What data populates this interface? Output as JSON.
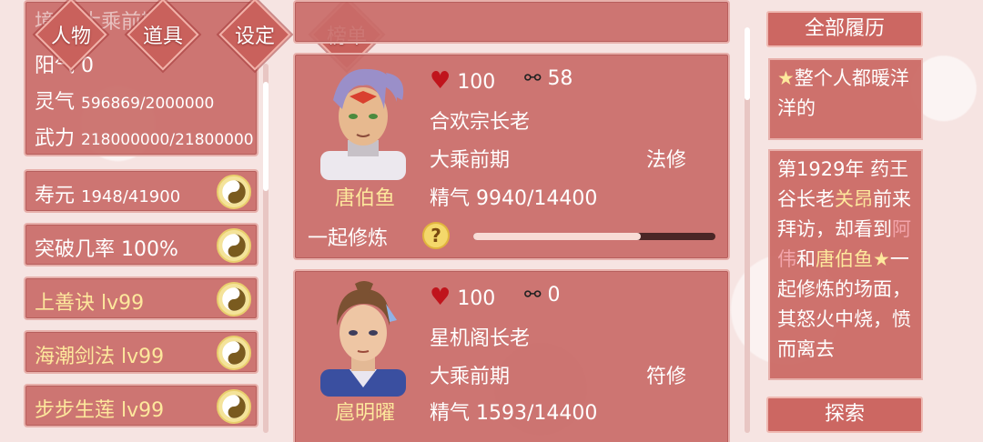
{
  "nav": {
    "tabs": [
      {
        "label": "人物"
      },
      {
        "label": "道具"
      },
      {
        "label": "设定"
      },
      {
        "label": "榜单"
      }
    ]
  },
  "player": {
    "title_partial": "境界 大乘前期",
    "yang_label": "阳气",
    "yang_value": "0",
    "spirit_label": "灵气",
    "spirit_value": "596869/2000000",
    "martial_label": "武力",
    "martial_value": "218000000/21800000"
  },
  "skills": [
    {
      "label": "寿元",
      "value": "1948/41900",
      "gold": false
    },
    {
      "label": "突破几率",
      "value": "100%",
      "gold": false
    },
    {
      "label": "上善诀",
      "value": "lv99",
      "gold": true
    },
    {
      "label": "海潮剑法",
      "value": "lv99",
      "gold": true
    },
    {
      "label": "步步生莲",
      "value": "lv99",
      "gold": true
    }
  ],
  "characters": [
    {
      "name": "唐伯鱼",
      "hp": "100",
      "bond": "58",
      "title": "合欢宗长老",
      "realm": "大乘前期",
      "cultivation_type": "法修",
      "vitality": "精气 9940/14400",
      "practice_label": "一起修炼",
      "practice_progress": 0.69
    },
    {
      "name": "扈明曜",
      "hp": "100",
      "bond": "0",
      "title": "星机阁长老",
      "realm": "大乘前期",
      "cultivation_type": "符修",
      "vitality": "精气 1593/14400"
    }
  ],
  "history": {
    "header_label": "全部履历",
    "entry1": {
      "star": "★",
      "text": "整个人都暖洋洋的"
    },
    "entry2": {
      "p1": "第1929年 药王谷长老",
      "name1": "关昂",
      "p2": "前来拜访，却看到",
      "name2": "阿伟",
      "p3": "和",
      "name3": "唐伯鱼",
      "star": "★",
      "p4": "一起修炼的场面，其怒火中烧，愤而离去"
    },
    "explore_label": "探索"
  },
  "colors": {
    "panel": "#c96b68",
    "gold_text": "#fde89c",
    "heart": "#c0141c",
    "background": "#f6e4e2"
  }
}
